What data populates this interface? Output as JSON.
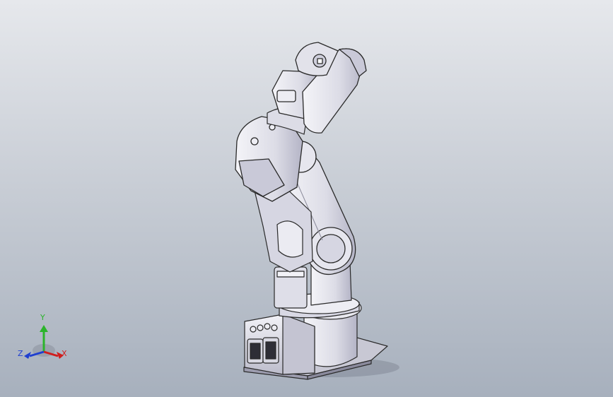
{
  "viewport": {
    "background_top": "#e6e8ec",
    "background_bottom": "#a7b0bd",
    "model_fill": "#e9e9ee",
    "model_shade": "#b9b9c8",
    "model_edge": "#2a2a2a"
  },
  "triad": {
    "y_label": "Y",
    "x_label": "X",
    "z_label": "Z",
    "y_color": "#2bb42b",
    "x_color": "#d01e1e",
    "z_color": "#1f3fd0"
  }
}
